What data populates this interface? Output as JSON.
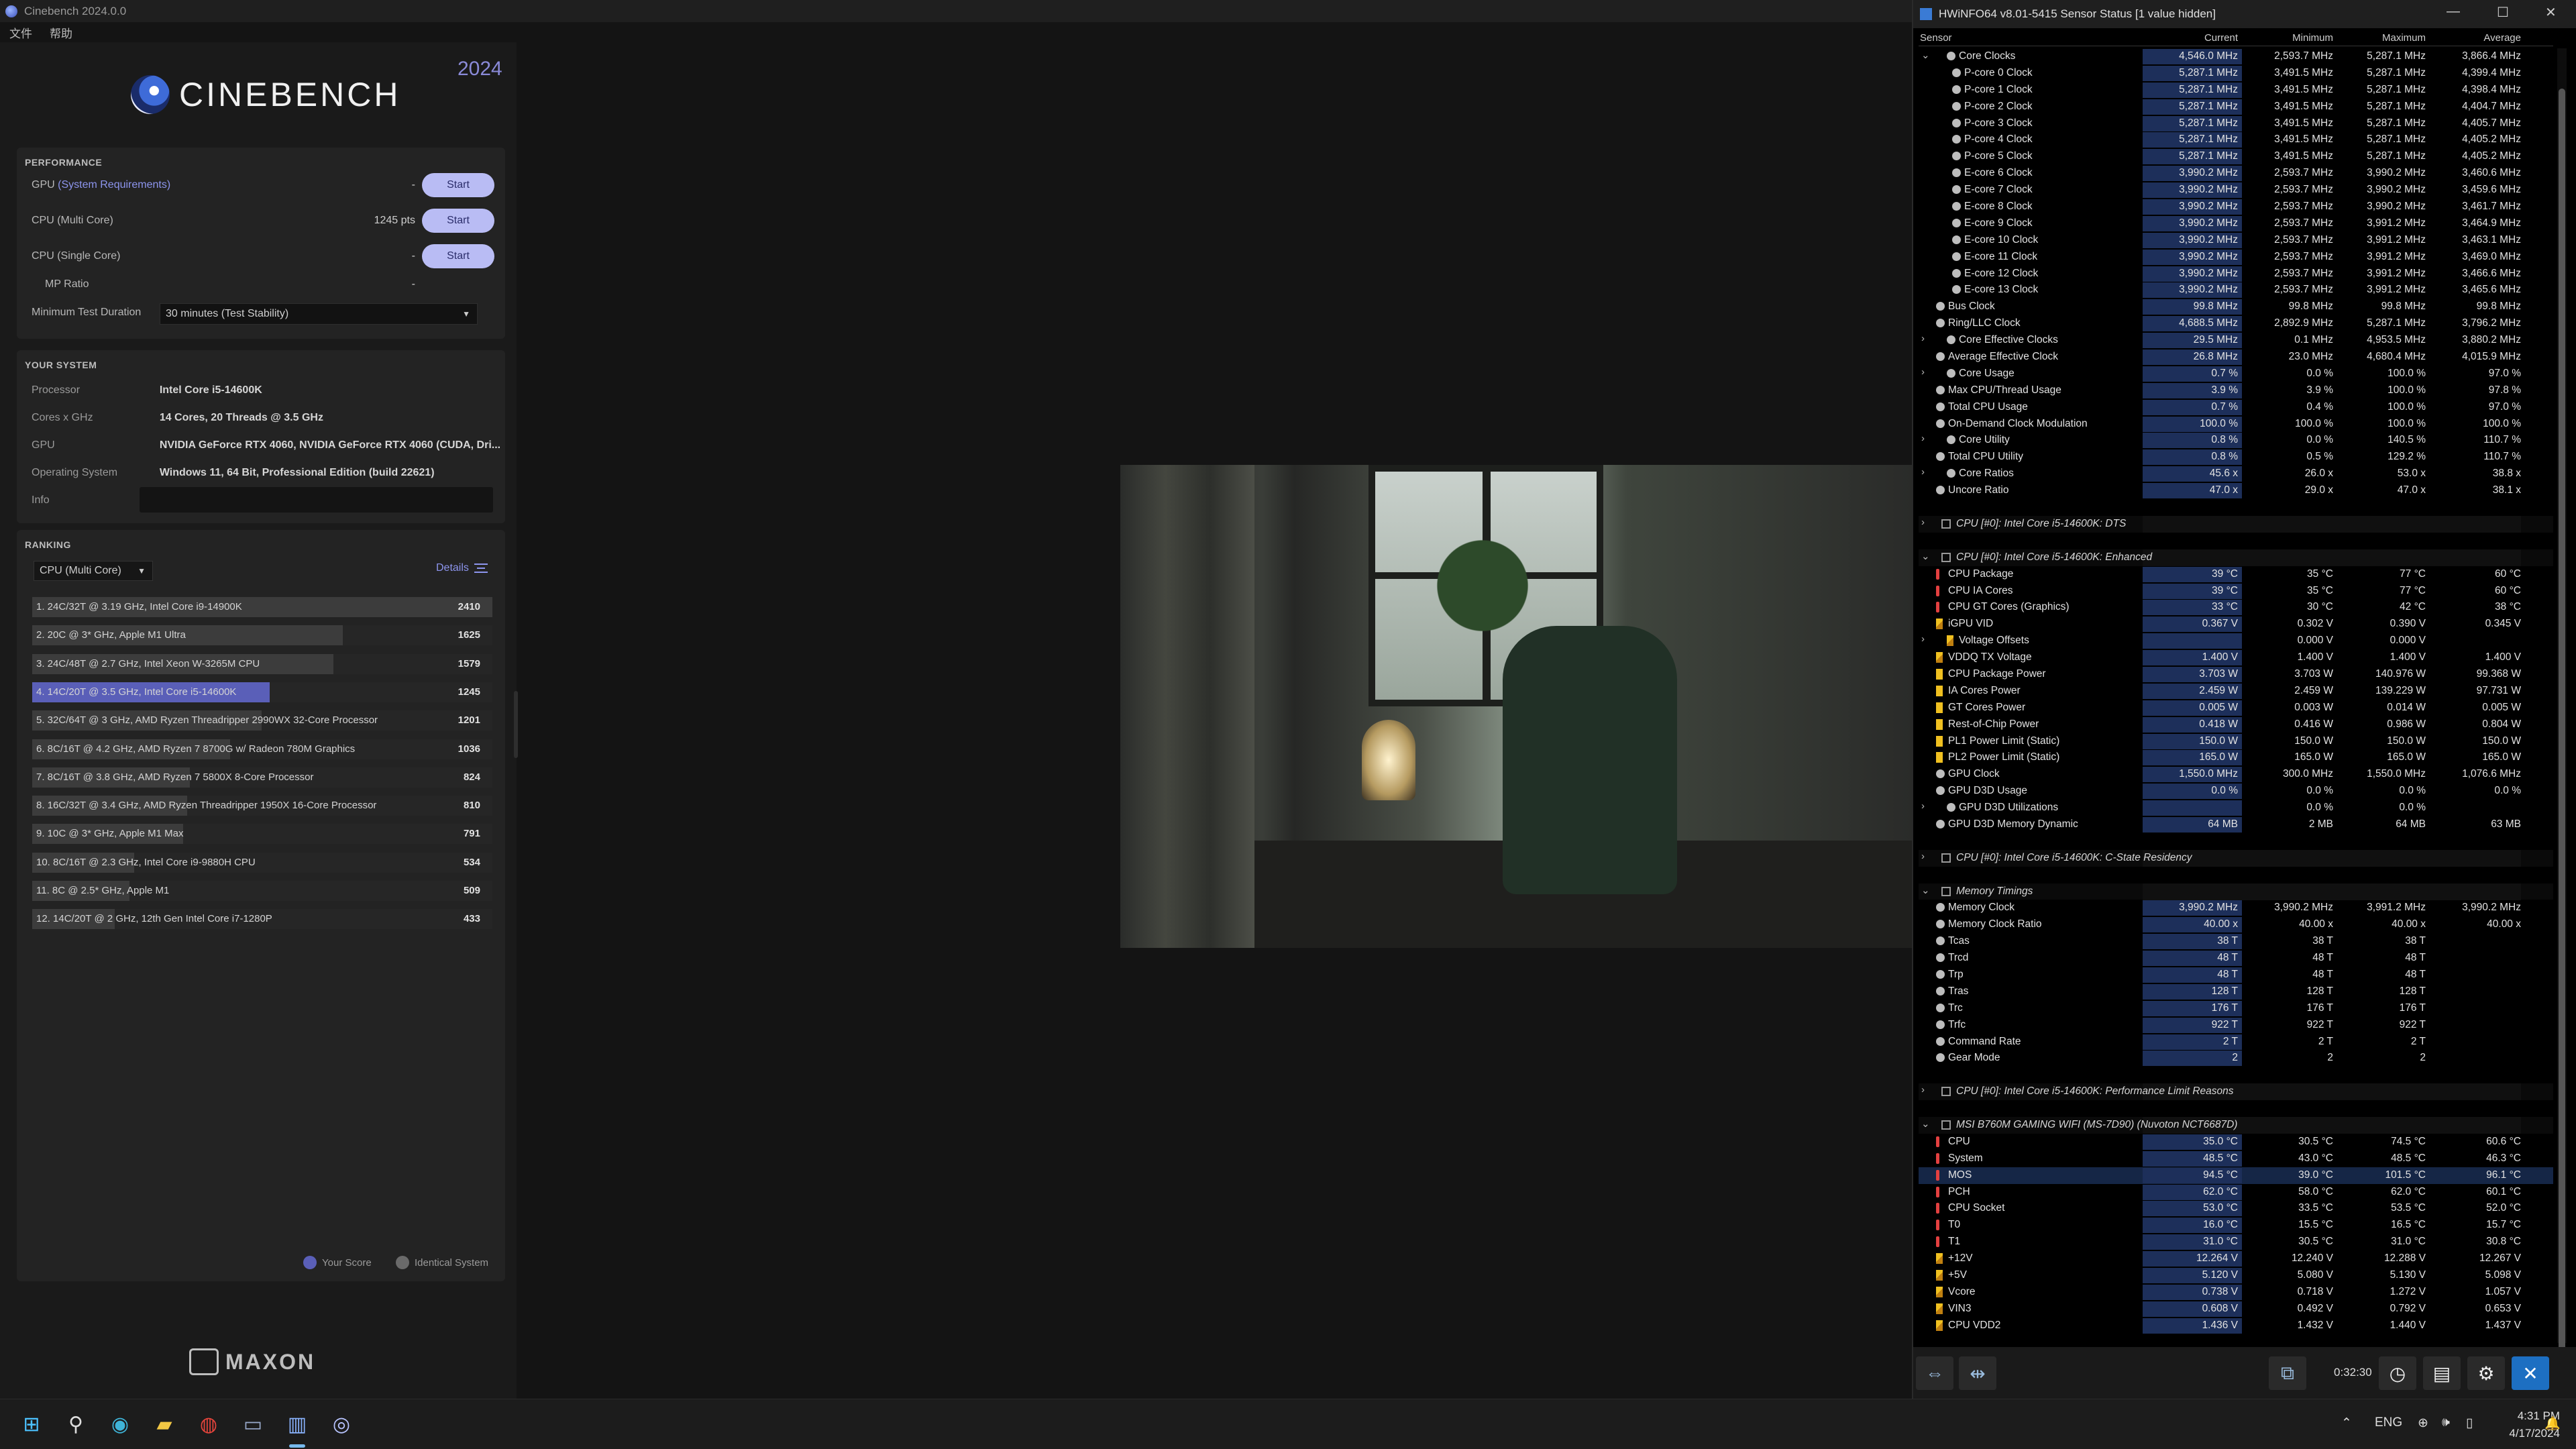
{
  "cinebench": {
    "window_title": "Cinebench 2024.0.0",
    "menu": [
      "文件",
      "帮助"
    ],
    "logo_text": "CINEBENCH",
    "year": "2024",
    "performance": {
      "heading": "PERFORMANCE",
      "gpu_label_prefix": "GPU",
      "gpu_label_suffix": "(System Requirements)",
      "gpu_value": "-",
      "cpu_multi_label": "CPU (Multi Core)",
      "cpu_multi_value": "1245 pts",
      "cpu_single_label": "CPU (Single Core)",
      "cpu_single_value": "-",
      "mp_ratio_label": "MP Ratio",
      "mp_ratio_value": "-",
      "start_label": "Start",
      "min_duration_label": "Minimum Test Duration",
      "min_duration_value": "30 minutes (Test Stability)"
    },
    "system": {
      "heading": "YOUR SYSTEM",
      "rows": [
        {
          "k": "Processor",
          "v": "Intel Core i5-14600K"
        },
        {
          "k": "Cores x GHz",
          "v": "14 Cores, 20 Threads @ 3.5 GHz"
        },
        {
          "k": "GPU",
          "v": "NVIDIA GeForce RTX 4060, NVIDIA GeForce RTX 4060 (CUDA, Dri..."
        },
        {
          "k": "Operating System",
          "v": "Windows 11, 64 Bit, Professional Edition (build 22621)"
        },
        {
          "k": "Info",
          "v": ""
        }
      ]
    },
    "ranking": {
      "heading": "RANKING",
      "select_value": "CPU (Multi Core)",
      "details_label": "Details",
      "rows": [
        {
          "name": "1. 24C/32T @ 3.19 GHz, Intel Core i9-14900K",
          "score": "2410"
        },
        {
          "name": "2. 20C @ 3* GHz, Apple M1 Ultra",
          "score": "1625"
        },
        {
          "name": "3. 24C/48T @ 2.7 GHz, Intel Xeon W-3265M CPU",
          "score": "1579"
        },
        {
          "name": "4. 14C/20T @ 3.5 GHz, Intel Core i5-14600K",
          "score": "1245"
        },
        {
          "name": "5. 32C/64T @ 3 GHz, AMD Ryzen Threadripper 2990WX 32-Core Processor",
          "score": "1201"
        },
        {
          "name": "6. 8C/16T @ 4.2 GHz, AMD Ryzen 7 8700G w/ Radeon 780M Graphics",
          "score": "1036"
        },
        {
          "name": "7. 8C/16T @ 3.8 GHz, AMD Ryzen 7 5800X 8-Core Processor",
          "score": "824"
        },
        {
          "name": "8. 16C/32T @ 3.4 GHz, AMD Ryzen Threadripper 1950X 16-Core Processor",
          "score": "810"
        },
        {
          "name": "9. 10C @ 3* GHz, Apple M1 Max",
          "score": "791"
        },
        {
          "name": "10. 8C/16T @ 2.3 GHz, Intel Core i9-9880H CPU",
          "score": "534"
        },
        {
          "name": "11. 8C @ 2.5* GHz, Apple M1",
          "score": "509"
        },
        {
          "name": "12. 14C/20T @ 2 GHz, 12th Gen Intel Core i7-1280P",
          "score": "433"
        }
      ],
      "legend_your_score": "Your Score",
      "legend_identical": "Identical System"
    },
    "brand": "MAXON"
  },
  "hwinfo": {
    "window_title": "HWiNFO64 v8.01-5415 Sensor Status [1 value hidden]",
    "columns": [
      "Sensor",
      "Current",
      "Minimum",
      "Maximum",
      "Average"
    ],
    "rows": [
      {
        "i": 1,
        "t": "c",
        "ex": "v",
        "n": "Core Clocks",
        "c": "4,546.0 MHz",
        "mn": "2,593.7 MHz",
        "mx": "5,287.1 MHz",
        "av": "3,866.4 MHz"
      },
      {
        "i": 2,
        "t": "c",
        "n": "P-core 0 Clock",
        "c": "5,287.1 MHz",
        "mn": "3,491.5 MHz",
        "mx": "5,287.1 MHz",
        "av": "4,399.4 MHz"
      },
      {
        "i": 2,
        "t": "c",
        "n": "P-core 1 Clock",
        "c": "5,287.1 MHz",
        "mn": "3,491.5 MHz",
        "mx": "5,287.1 MHz",
        "av": "4,398.4 MHz"
      },
      {
        "i": 2,
        "t": "c",
        "n": "P-core 2 Clock",
        "c": "5,287.1 MHz",
        "mn": "3,491.5 MHz",
        "mx": "5,287.1 MHz",
        "av": "4,404.7 MHz"
      },
      {
        "i": 2,
        "t": "c",
        "n": "P-core 3 Clock",
        "c": "5,287.1 MHz",
        "mn": "3,491.5 MHz",
        "mx": "5,287.1 MHz",
        "av": "4,405.7 MHz"
      },
      {
        "i": 2,
        "t": "c",
        "n": "P-core 4 Clock",
        "c": "5,287.1 MHz",
        "mn": "3,491.5 MHz",
        "mx": "5,287.1 MHz",
        "av": "4,405.2 MHz"
      },
      {
        "i": 2,
        "t": "c",
        "n": "P-core 5 Clock",
        "c": "5,287.1 MHz",
        "mn": "3,491.5 MHz",
        "mx": "5,287.1 MHz",
        "av": "4,405.2 MHz"
      },
      {
        "i": 2,
        "t": "c",
        "n": "E-core 6 Clock",
        "c": "3,990.2 MHz",
        "mn": "2,593.7 MHz",
        "mx": "3,990.2 MHz",
        "av": "3,460.6 MHz"
      },
      {
        "i": 2,
        "t": "c",
        "n": "E-core 7 Clock",
        "c": "3,990.2 MHz",
        "mn": "2,593.7 MHz",
        "mx": "3,990.2 MHz",
        "av": "3,459.6 MHz"
      },
      {
        "i": 2,
        "t": "c",
        "n": "E-core 8 Clock",
        "c": "3,990.2 MHz",
        "mn": "2,593.7 MHz",
        "mx": "3,990.2 MHz",
        "av": "3,461.7 MHz"
      },
      {
        "i": 2,
        "t": "c",
        "n": "E-core 9 Clock",
        "c": "3,990.2 MHz",
        "mn": "2,593.7 MHz",
        "mx": "3,991.2 MHz",
        "av": "3,464.9 MHz"
      },
      {
        "i": 2,
        "t": "c",
        "n": "E-core 10 Clock",
        "c": "3,990.2 MHz",
        "mn": "2,593.7 MHz",
        "mx": "3,991.2 MHz",
        "av": "3,463.1 MHz"
      },
      {
        "i": 2,
        "t": "c",
        "n": "E-core 11 Clock",
        "c": "3,990.2 MHz",
        "mn": "2,593.7 MHz",
        "mx": "3,991.2 MHz",
        "av": "3,469.0 MHz"
      },
      {
        "i": 2,
        "t": "c",
        "n": "E-core 12 Clock",
        "c": "3,990.2 MHz",
        "mn": "2,593.7 MHz",
        "mx": "3,991.2 MHz",
        "av": "3,466.6 MHz"
      },
      {
        "i": 2,
        "t": "c",
        "n": "E-core 13 Clock",
        "c": "3,990.2 MHz",
        "mn": "2,593.7 MHz",
        "mx": "3,991.2 MHz",
        "av": "3,465.6 MHz"
      },
      {
        "i": 0,
        "t": "c",
        "n": "Bus Clock",
        "c": "99.8 MHz",
        "mn": "99.8 MHz",
        "mx": "99.8 MHz",
        "av": "99.8 MHz"
      },
      {
        "i": 0,
        "t": "c",
        "n": "Ring/LLC Clock",
        "c": "4,688.5 MHz",
        "mn": "2,892.9 MHz",
        "mx": "5,287.1 MHz",
        "av": "3,796.2 MHz"
      },
      {
        "i": 1,
        "t": "c",
        "ex": ">",
        "n": "Core Effective Clocks",
        "c": "29.5 MHz",
        "mn": "0.1 MHz",
        "mx": "4,953.5 MHz",
        "av": "3,880.2 MHz"
      },
      {
        "i": 0,
        "t": "c",
        "n": "Average Effective Clock",
        "c": "26.8 MHz",
        "mn": "23.0 MHz",
        "mx": "4,680.4 MHz",
        "av": "4,015.9 MHz"
      },
      {
        "i": 1,
        "t": "c",
        "ex": ">",
        "n": "Core Usage",
        "c": "0.7 %",
        "mn": "0.0 %",
        "mx": "100.0 %",
        "av": "97.0 %"
      },
      {
        "i": 0,
        "t": "c",
        "n": "Max CPU/Thread Usage",
        "c": "3.9 %",
        "mn": "3.9 %",
        "mx": "100.0 %",
        "av": "97.8 %"
      },
      {
        "i": 0,
        "t": "c",
        "n": "Total CPU Usage",
        "c": "0.7 %",
        "mn": "0.4 %",
        "mx": "100.0 %",
        "av": "97.0 %"
      },
      {
        "i": 0,
        "t": "c",
        "n": "On-Demand Clock Modulation",
        "c": "100.0 %",
        "mn": "100.0 %",
        "mx": "100.0 %",
        "av": "100.0 %"
      },
      {
        "i": 1,
        "t": "c",
        "ex": ">",
        "n": "Core Utility",
        "c": "0.8 %",
        "mn": "0.0 %",
        "mx": "140.5 %",
        "av": "110.7 %"
      },
      {
        "i": 0,
        "t": "c",
        "n": "Total CPU Utility",
        "c": "0.8 %",
        "mn": "0.5 %",
        "mx": "129.2 %",
        "av": "110.7 %"
      },
      {
        "i": 1,
        "t": "c",
        "ex": ">",
        "n": "Core Ratios",
        "c": "45.6 x",
        "mn": "26.0 x",
        "mx": "53.0 x",
        "av": "38.8 x"
      },
      {
        "i": 0,
        "t": "c",
        "n": "Uncore Ratio",
        "c": "47.0 x",
        "mn": "29.0 x",
        "mx": "47.0 x",
        "av": "38.1 x"
      },
      {
        "blank": true
      },
      {
        "grp": true,
        "ex": ">",
        "n": "CPU [#0]: Intel Core i5-14600K: DTS"
      },
      {
        "blank": true
      },
      {
        "grp": true,
        "ex": "v",
        "n": "CPU [#0]: Intel Core i5-14600K: Enhanced"
      },
      {
        "i": 0,
        "t": "temp",
        "n": "CPU Package",
        "c": "39 °C",
        "mn": "35 °C",
        "mx": "77 °C",
        "av": "60 °C"
      },
      {
        "i": 0,
        "t": "temp",
        "n": "CPU IA Cores",
        "c": "39 °C",
        "mn": "35 °C",
        "mx": "77 °C",
        "av": "60 °C"
      },
      {
        "i": 0,
        "t": "temp",
        "n": "CPU GT Cores (Graphics)",
        "c": "33 °C",
        "mn": "30 °C",
        "mx": "42 °C",
        "av": "38 °C"
      },
      {
        "i": 0,
        "t": "volt",
        "n": "iGPU VID",
        "c": "0.367 V",
        "mn": "0.302 V",
        "mx": "0.390 V",
        "av": "0.345 V"
      },
      {
        "i": 1,
        "t": "volt",
        "ex": ">",
        "n": "Voltage Offsets",
        "c": "",
        "mn": "0.000 V",
        "mx": "0.000 V",
        "av": ""
      },
      {
        "i": 0,
        "t": "volt",
        "n": "VDDQ TX Voltage",
        "c": "1.400 V",
        "mn": "1.400 V",
        "mx": "1.400 V",
        "av": "1.400 V"
      },
      {
        "i": 0,
        "t": "pwr",
        "n": "CPU Package Power",
        "c": "3.703 W",
        "mn": "3.703 W",
        "mx": "140.976 W",
        "av": "99.368 W"
      },
      {
        "i": 0,
        "t": "pwr",
        "n": "IA Cores Power",
        "c": "2.459 W",
        "mn": "2.459 W",
        "mx": "139.229 W",
        "av": "97.731 W"
      },
      {
        "i": 0,
        "t": "pwr",
        "n": "GT Cores Power",
        "c": "0.005 W",
        "mn": "0.003 W",
        "mx": "0.014 W",
        "av": "0.005 W"
      },
      {
        "i": 0,
        "t": "pwr",
        "n": "Rest-of-Chip Power",
        "c": "0.418 W",
        "mn": "0.416 W",
        "mx": "0.986 W",
        "av": "0.804 W"
      },
      {
        "i": 0,
        "t": "pwr",
        "n": "PL1 Power Limit (Static)",
        "c": "150.0 W",
        "mn": "150.0 W",
        "mx": "150.0 W",
        "av": "150.0 W"
      },
      {
        "i": 0,
        "t": "pwr",
        "n": "PL2 Power Limit (Static)",
        "c": "165.0 W",
        "mn": "165.0 W",
        "mx": "165.0 W",
        "av": "165.0 W"
      },
      {
        "i": 0,
        "t": "c",
        "n": "GPU Clock",
        "c": "1,550.0 MHz",
        "mn": "300.0 MHz",
        "mx": "1,550.0 MHz",
        "av": "1,076.6 MHz"
      },
      {
        "i": 0,
        "t": "c",
        "n": "GPU D3D Usage",
        "c": "0.0 %",
        "mn": "0.0 %",
        "mx": "0.0 %",
        "av": "0.0 %"
      },
      {
        "i": 1,
        "t": "c",
        "ex": ">",
        "n": "GPU D3D Utilizations",
        "c": "",
        "mn": "0.0 %",
        "mx": "0.0 %",
        "av": ""
      },
      {
        "i": 0,
        "t": "c",
        "n": "GPU D3D Memory Dynamic",
        "c": "64 MB",
        "mn": "2 MB",
        "mx": "64 MB",
        "av": "63 MB"
      },
      {
        "blank": true
      },
      {
        "grp": true,
        "ex": ">",
        "n": "CPU [#0]: Intel Core i5-14600K: C-State Residency"
      },
      {
        "blank": true
      },
      {
        "grp": true,
        "ex": "v",
        "n": "Memory Timings"
      },
      {
        "i": 0,
        "t": "c",
        "n": "Memory Clock",
        "c": "3,990.2 MHz",
        "mn": "3,990.2 MHz",
        "mx": "3,991.2 MHz",
        "av": "3,990.2 MHz"
      },
      {
        "i": 0,
        "t": "c",
        "n": "Memory Clock Ratio",
        "c": "40.00 x",
        "mn": "40.00 x",
        "mx": "40.00 x",
        "av": "40.00 x"
      },
      {
        "i": 0,
        "t": "c",
        "n": "Tcas",
        "c": "38 T",
        "mn": "38 T",
        "mx": "38 T",
        "av": ""
      },
      {
        "i": 0,
        "t": "c",
        "n": "Trcd",
        "c": "48 T",
        "mn": "48 T",
        "mx": "48 T",
        "av": ""
      },
      {
        "i": 0,
        "t": "c",
        "n": "Trp",
        "c": "48 T",
        "mn": "48 T",
        "mx": "48 T",
        "av": ""
      },
      {
        "i": 0,
        "t": "c",
        "n": "Tras",
        "c": "128 T",
        "mn": "128 T",
        "mx": "128 T",
        "av": ""
      },
      {
        "i": 0,
        "t": "c",
        "n": "Trc",
        "c": "176 T",
        "mn": "176 T",
        "mx": "176 T",
        "av": ""
      },
      {
        "i": 0,
        "t": "c",
        "n": "Trfc",
        "c": "922 T",
        "mn": "922 T",
        "mx": "922 T",
        "av": ""
      },
      {
        "i": 0,
        "t": "c",
        "n": "Command Rate",
        "c": "2 T",
        "mn": "2 T",
        "mx": "2 T",
        "av": ""
      },
      {
        "i": 0,
        "t": "c",
        "n": "Gear Mode",
        "c": "2",
        "mn": "2",
        "mx": "2",
        "av": ""
      },
      {
        "blank": true
      },
      {
        "grp": true,
        "ex": ">",
        "n": "CPU [#0]: Intel Core i5-14600K: Performance Limit Reasons"
      },
      {
        "blank": true
      },
      {
        "grp": true,
        "ex": "v",
        "n": "MSI B760M GAMING WIFI (MS-7D90) (Nuvoton NCT6687D)"
      },
      {
        "i": 0,
        "t": "temp",
        "n": "CPU",
        "c": "35.0 °C",
        "mn": "30.5 °C",
        "mx": "74.5 °C",
        "av": "60.6 °C"
      },
      {
        "i": 0,
        "t": "temp",
        "n": "System",
        "c": "48.5 °C",
        "mn": "43.0 °C",
        "mx": "48.5 °C",
        "av": "46.3 °C"
      },
      {
        "i": 0,
        "t": "temp",
        "sel": true,
        "n": "MOS",
        "c": "94.5 °C",
        "mn": "39.0 °C",
        "mx": "101.5 °C",
        "av": "96.1 °C"
      },
      {
        "i": 0,
        "t": "temp",
        "n": "PCH",
        "c": "62.0 °C",
        "mn": "58.0 °C",
        "mx": "62.0 °C",
        "av": "60.1 °C"
      },
      {
        "i": 0,
        "t": "temp",
        "n": "CPU Socket",
        "c": "53.0 °C",
        "mn": "33.5 °C",
        "mx": "53.5 °C",
        "av": "52.0 °C"
      },
      {
        "i": 0,
        "t": "temp",
        "n": "T0",
        "c": "16.0 °C",
        "mn": "15.5 °C",
        "mx": "16.5 °C",
        "av": "15.7 °C"
      },
      {
        "i": 0,
        "t": "temp",
        "n": "T1",
        "c": "31.0 °C",
        "mn": "30.5 °C",
        "mx": "31.0 °C",
        "av": "30.8 °C"
      },
      {
        "i": 0,
        "t": "volt",
        "n": "+12V",
        "c": "12.264 V",
        "mn": "12.240 V",
        "mx": "12.288 V",
        "av": "12.267 V"
      },
      {
        "i": 0,
        "t": "volt",
        "n": "+5V",
        "c": "5.120 V",
        "mn": "5.080 V",
        "mx": "5.130 V",
        "av": "5.098 V"
      },
      {
        "i": 0,
        "t": "volt",
        "n": "Vcore",
        "c": "0.738 V",
        "mn": "0.718 V",
        "mx": "1.272 V",
        "av": "1.057 V"
      },
      {
        "i": 0,
        "t": "volt",
        "n": "VIN3",
        "c": "0.608 V",
        "mn": "0.492 V",
        "mx": "0.792 V",
        "av": "0.653 V"
      },
      {
        "i": 0,
        "t": "volt",
        "n": "CPU VDD2",
        "c": "1.436 V",
        "mn": "1.432 V",
        "mx": "1.440 V",
        "av": "1.437 V"
      }
    ],
    "elapsed": "0:32:30"
  },
  "taskbar": {
    "language": "ENG",
    "time": "4:31 PM",
    "date": "4/17/2024"
  }
}
